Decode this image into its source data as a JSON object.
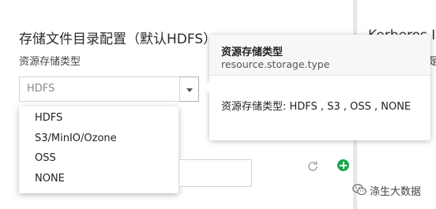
{
  "section": {
    "title": "存储文件目录配置（默认HDFS）",
    "storage_label": "资源存储类型"
  },
  "storage_select": {
    "value": "HDFS",
    "options": [
      "HDFS",
      "S3/MinIO/Ozone",
      "OSS",
      "NONE"
    ]
  },
  "right_panel": {
    "title": "Kerberos In",
    "hint": "是"
  },
  "tooltip": {
    "title": "资源存储类型",
    "key": "resource.storage.type",
    "description": "资源存储类型: HDFS , S3 , OSS , NONE"
  },
  "text_input": {
    "value": ""
  },
  "icons": {
    "dropdown": "chevron-down-icon",
    "refresh": "refresh-icon",
    "add": "add-circle-icon",
    "watermark": "wechat-icon"
  },
  "colors": {
    "add_button": "#1aa64a"
  },
  "watermark": {
    "text": "涤生大数据"
  }
}
